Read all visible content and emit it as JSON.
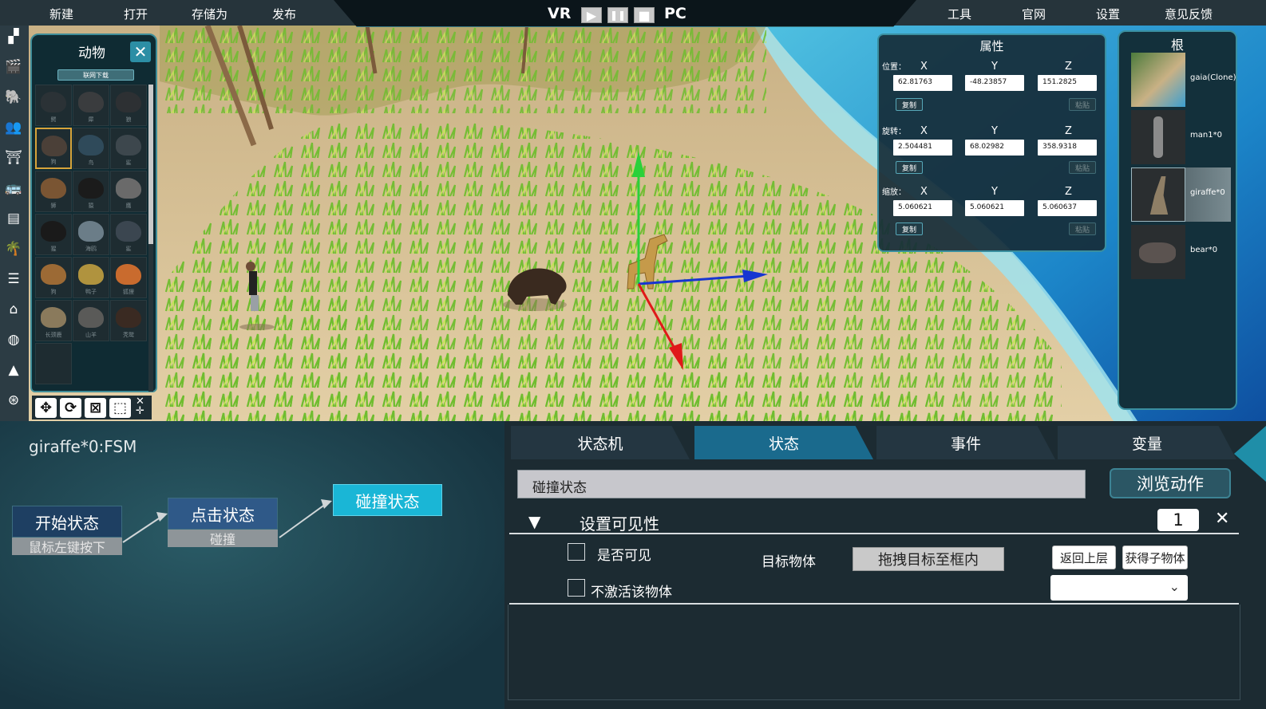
{
  "menu": {
    "new": "新建",
    "open": "打开",
    "save_as": "存储为",
    "publish": "发布",
    "tools": "工具",
    "website": "官网",
    "settings": "设置",
    "feedback": "意见反馈"
  },
  "mode": {
    "vr": "VR",
    "pc": "PC"
  },
  "animal_panel": {
    "title": "动物",
    "download_label": "联网下载",
    "cell_labels": [
      "鳄",
      "犀",
      "狼",
      "狗",
      "鸟",
      "鲨",
      "狮",
      "猿",
      "鹰",
      "猩",
      "海鸥",
      "鲨",
      "狗",
      "鸭子",
      "狐狸",
      "长颈鹿",
      "山羊",
      "秃鹫"
    ]
  },
  "properties": {
    "title": "属性",
    "position_label": "位置：",
    "rotation_label": "旋转：",
    "scale_label": "缩放：",
    "axis_x": "X",
    "axis_y": "Y",
    "axis_z": "Z",
    "copy": "复制",
    "paste": "粘贴",
    "position": [
      "62.81763",
      "-48.23857",
      "151.2825"
    ],
    "rotation": [
      "2.504481",
      "68.02982",
      "358.9318"
    ],
    "scale": [
      "5.060621",
      "5.060621",
      "5.060637"
    ]
  },
  "hierarchy": {
    "title": "根",
    "items": [
      {
        "name": "gaia(Clone)"
      },
      {
        "name": "man1*0"
      },
      {
        "name": "giraffe*0"
      },
      {
        "name": "bear*0"
      }
    ]
  },
  "fsm": {
    "title": "giraffe*0:FSM",
    "nodes": [
      {
        "label": "开始状态",
        "sub": "鼠标左键按下"
      },
      {
        "label": "点击状态",
        "sub": "碰撞"
      },
      {
        "label": "碰撞状态"
      }
    ]
  },
  "tabs": [
    "状态机",
    "状态",
    "事件",
    "变量"
  ],
  "state": {
    "name": "碰撞状态",
    "browse_label": "浏览动作",
    "action_title": "设置可见性",
    "action_index": "1",
    "visible_label": "是否可见",
    "deactivate_label": "不激活该物体",
    "target_label": "目标物体",
    "drag_label": "拖拽目标至框内",
    "back_label": "返回上层",
    "get_child_label": "获得子物体",
    "dropdown_value": ""
  },
  "colors": {
    "accent": "#1a6a8d",
    "panel_border": "#3a8fa0",
    "node_active": "#1ab6d6",
    "node_default": "#1e3f62"
  }
}
